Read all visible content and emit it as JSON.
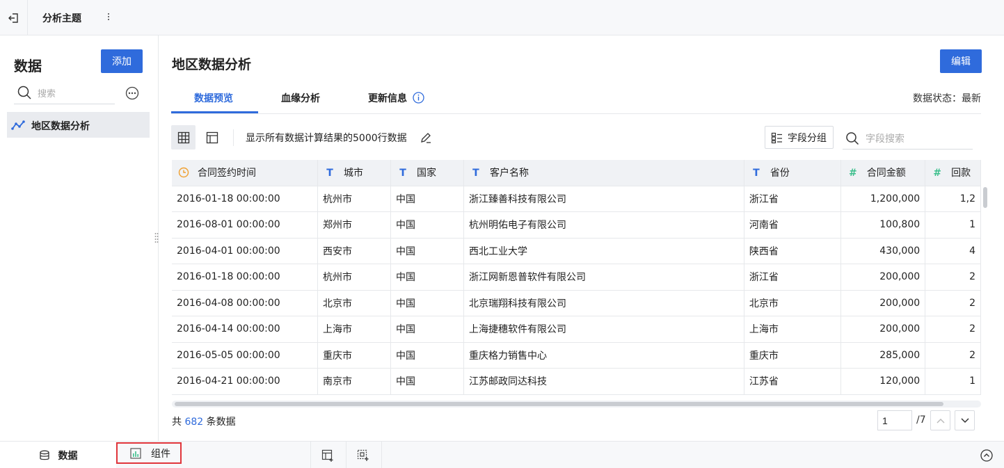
{
  "topbar": {
    "title": "分析主题"
  },
  "left": {
    "header": "数据",
    "add_label": "添加",
    "search_placeholder": "搜索",
    "items": [
      {
        "label": "地区数据分析"
      }
    ]
  },
  "main": {
    "title": "地区数据分析",
    "edit_label": "编辑",
    "tabs": [
      {
        "label": "数据预览"
      },
      {
        "label": "血缘分析"
      },
      {
        "label": "更新信息"
      }
    ],
    "data_status": "数据状态：最新",
    "toolbar": {
      "description": "显示所有数据计算结果的5000行数据",
      "field_group_label": "字段分组",
      "field_search_placeholder": "字段搜索"
    }
  },
  "table": {
    "columns": [
      {
        "label": "合同签约时间",
        "type": "date"
      },
      {
        "label": "城市",
        "type": "text"
      },
      {
        "label": "国家",
        "type": "text"
      },
      {
        "label": "客户名称",
        "type": "text"
      },
      {
        "label": "省份",
        "type": "text"
      },
      {
        "label": "合同金额",
        "type": "number"
      },
      {
        "label": "回款",
        "type": "number"
      }
    ],
    "rows": [
      [
        "2016-01-18 00:00:00",
        "杭州市",
        "中国",
        "浙江臻善科技有限公司",
        "浙江省",
        "1,200,000",
        "1,2"
      ],
      [
        "2016-08-01 00:00:00",
        "郑州市",
        "中国",
        "杭州明佑电子有限公司",
        "河南省",
        "100,800",
        "1"
      ],
      [
        "2016-04-01 00:00:00",
        "西安市",
        "中国",
        "西北工业大学",
        "陕西省",
        "430,000",
        "4"
      ],
      [
        "2016-01-18 00:00:00",
        "杭州市",
        "中国",
        "浙江网新恩普软件有限公司",
        "浙江省",
        "200,000",
        "2"
      ],
      [
        "2016-04-08 00:00:00",
        "北京市",
        "中国",
        "北京瑞翔科技有限公司",
        "北京市",
        "200,000",
        "2"
      ],
      [
        "2016-04-14 00:00:00",
        "上海市",
        "中国",
        "上海捷穗软件有限公司",
        "上海市",
        "200,000",
        "2"
      ],
      [
        "2016-05-05 00:00:00",
        "重庆市",
        "中国",
        "重庆格力销售中心",
        "重庆市",
        "285,000",
        "2"
      ],
      [
        "2016-04-21 00:00:00",
        "南京市",
        "中国",
        "江苏邮政同达科技",
        "江苏省",
        "120,000",
        "1"
      ]
    ]
  },
  "footer": {
    "count_prefix": "共",
    "count": "682",
    "count_suffix": "条数据",
    "page_value": "1",
    "page_total": "/7"
  },
  "bottombar": {
    "tabs": [
      {
        "label": "数据"
      },
      {
        "label": "组件"
      }
    ]
  },
  "colors": {
    "accent": "#2f6bdc",
    "highlight_border": "#e0353b",
    "number_type": "#3dbf8d",
    "date_type": "#f0a030"
  }
}
